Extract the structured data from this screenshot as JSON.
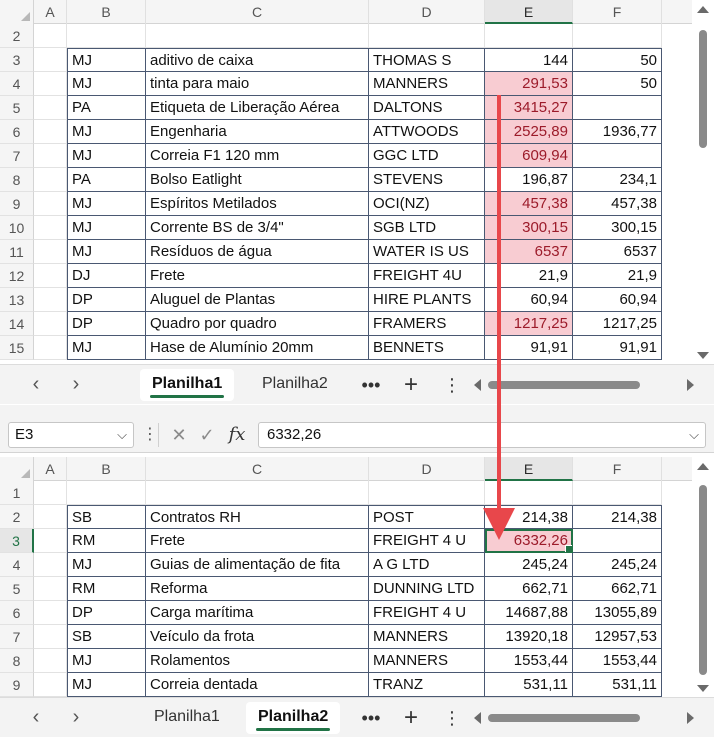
{
  "columns": [
    "A",
    "B",
    "C",
    "D",
    "E",
    "F"
  ],
  "sheet1": {
    "rows": [
      {
        "num": "2",
        "b": "",
        "c": "",
        "d": "",
        "e": "",
        "f": "",
        "table": false,
        "hl": false
      },
      {
        "num": "3",
        "b": "MJ",
        "c": "aditivo de caixa",
        "d": "THOMAS S",
        "e": "144",
        "f": "50",
        "table": true,
        "hl": false
      },
      {
        "num": "4",
        "b": "MJ",
        "c": "tinta para maio",
        "d": "MANNERS",
        "e": "291,53",
        "f": "50",
        "table": true,
        "hl": true
      },
      {
        "num": "5",
        "b": "PA",
        "c": "Etiqueta de Liberação Aérea",
        "d": "DALTONS",
        "e": "3415,27",
        "f": "",
        "table": true,
        "hl": true
      },
      {
        "num": "6",
        "b": "MJ",
        "c": "Engenharia",
        "d": "ATTWOODS",
        "e": "2525,89",
        "f": "1936,77",
        "table": true,
        "hl": true
      },
      {
        "num": "7",
        "b": "MJ",
        "c": "Correia F1 120 mm",
        "d": "GGC LTD",
        "e": "609,94",
        "f": "",
        "table": true,
        "hl": true
      },
      {
        "num": "8",
        "b": "PA",
        "c": "Bolso Eatlight",
        "d": "STEVENS",
        "e": "196,87",
        "f": "234,1",
        "table": true,
        "hl": false
      },
      {
        "num": "9",
        "b": "MJ",
        "c": "Espíritos Metilados",
        "d": "OCI(NZ)",
        "e": "457,38",
        "f": "457,38",
        "table": true,
        "hl": true
      },
      {
        "num": "10",
        "b": "MJ",
        "c": "Corrente BS de 3/4\"",
        "d": "SGB LTD",
        "e": "300,15",
        "f": "300,15",
        "table": true,
        "hl": true
      },
      {
        "num": "11",
        "b": "MJ",
        "c": "Resíduos de água",
        "d": "WATER IS US",
        "e": "6537",
        "f": "6537",
        "table": true,
        "hl": true
      },
      {
        "num": "12",
        "b": "DJ",
        "c": "Frete",
        "d": "FREIGHT 4U",
        "e": "21,9",
        "f": "21,9",
        "table": true,
        "hl": false
      },
      {
        "num": "13",
        "b": "DP",
        "c": "Aluguel de Plantas",
        "d": "HIRE PLANTS",
        "e": "60,94",
        "f": "60,94",
        "table": true,
        "hl": false
      },
      {
        "num": "14",
        "b": "DP",
        "c": "Quadro por quadro",
        "d": "FRAMERS",
        "e": "1217,25",
        "f": "1217,25",
        "table": true,
        "hl": true
      },
      {
        "num": "15",
        "b": "MJ",
        "c": "Hase de Alumínio 20mm",
        "d": "BENNETS",
        "e": "91,91",
        "f": "91,91",
        "table": true,
        "hl": false
      }
    ]
  },
  "sheet2": {
    "rows": [
      {
        "num": "1",
        "b": "",
        "c": "",
        "d": "",
        "e": "",
        "f": "",
        "table": false,
        "hl": false
      },
      {
        "num": "2",
        "b": "SB",
        "c": "Contratos RH",
        "d": "POST",
        "e": "214,38",
        "f": "214,38",
        "table": true,
        "hl": false
      },
      {
        "num": "3",
        "b": "RM",
        "c": "Frete",
        "d": "FREIGHT 4 U",
        "e": "6332,26",
        "f": "",
        "table": true,
        "hl": true,
        "active": true
      },
      {
        "num": "4",
        "b": "MJ",
        "c": "Guias de alimentação de fita",
        "d": "A G LTD",
        "e": "245,24",
        "f": "245,24",
        "table": true,
        "hl": false
      },
      {
        "num": "5",
        "b": "RM",
        "c": "Reforma",
        "d": "DUNNING LTD",
        "e": "662,71",
        "f": "662,71",
        "table": true,
        "hl": false
      },
      {
        "num": "6",
        "b": "DP",
        "c": "Carga marítima",
        "d": "FREIGHT 4 U",
        "e": "14687,88",
        "f": "13055,89",
        "table": true,
        "hl": false
      },
      {
        "num": "7",
        "b": "SB",
        "c": "Veículo da frota",
        "d": "MANNERS",
        "e": "13920,18",
        "f": "12957,53",
        "table": true,
        "hl": false
      },
      {
        "num": "8",
        "b": "MJ",
        "c": "Rolamentos",
        "d": "MANNERS",
        "e": "1553,44",
        "f": "1553,44",
        "table": true,
        "hl": false
      },
      {
        "num": "9",
        "b": "MJ",
        "c": "Correia dentada",
        "d": "TRANZ",
        "e": "531,11",
        "f": "531,11",
        "table": true,
        "hl": false
      }
    ]
  },
  "tabs": {
    "sheet1": "Planilha1",
    "sheet2": "Planilha2"
  },
  "tabbar1_active": "sheet1",
  "tabbar2_active": "sheet2",
  "formula_bar": {
    "name_box": "E3",
    "formula": "6332,26",
    "fx": "fx"
  },
  "icons": {
    "prev": "chevron-left-icon",
    "next": "chevron-right-icon",
    "more": "ellipsis-icon",
    "add": "plus-icon",
    "options": "vertical-ellipsis-icon",
    "cancel": "x-icon",
    "enter": "checkmark-icon",
    "dropdown": "chevron-down-icon"
  },
  "colors": {
    "highlight_fill": "#f8ccd2",
    "highlight_text": "#9c1b2a",
    "accent": "#217346",
    "arrow": "#e8474b"
  }
}
